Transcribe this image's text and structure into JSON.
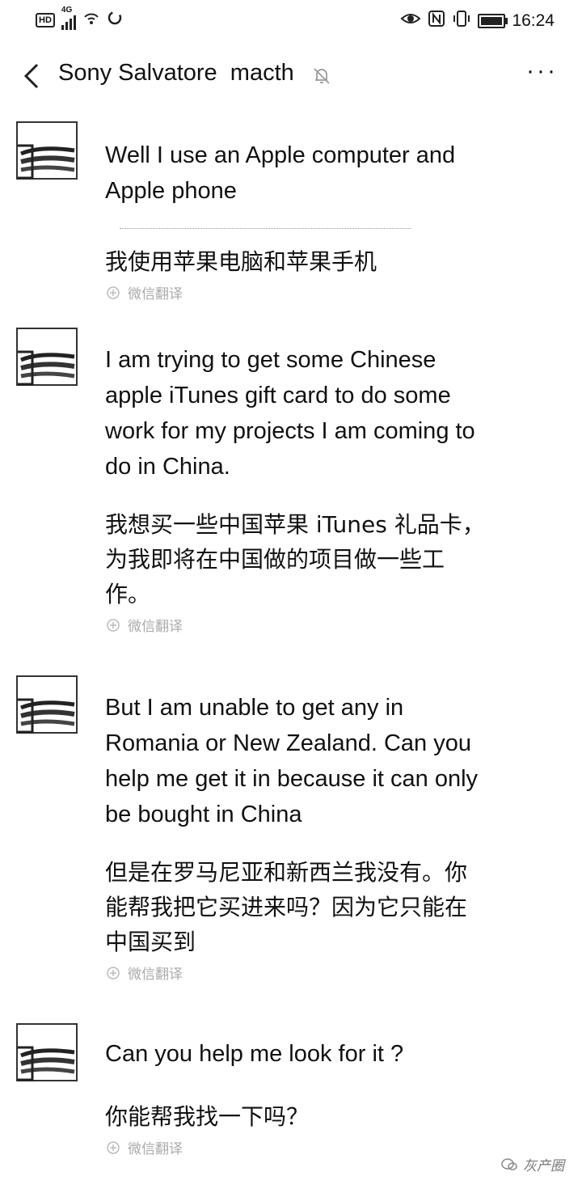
{
  "status_bar": {
    "hd": "HD",
    "network": "4G",
    "time": "16:24",
    "icons": [
      "signal-icon",
      "wifi-icon",
      "sync-icon",
      "eye-icon",
      "nfc-icon",
      "vibrate-icon",
      "battery-icon"
    ]
  },
  "header": {
    "title": "Sony Salvatore  macth",
    "back_icon": "chevron-left-icon",
    "mute_icon": "bell-off-icon",
    "more_label": "···"
  },
  "messages": [
    {
      "en": "Well I use an Apple computer and Apple phone",
      "zh": "我使用苹果电脑和苹果手机",
      "translate_label": "微信翻译"
    },
    {
      "en": "I am trying to get some Chinese apple iTunes gift card to do some work for my projects I am coming to do in China.",
      "zh": "我想买一些中国苹果 iTunes 礼品卡，为我即将在中国做的项目做一些工作。",
      "translate_label": "微信翻译"
    },
    {
      "en": "But I am unable to get any in Romania or New Zealand. Can you help me get it in because it can only be bought in China",
      "zh": "但是在罗马尼亚和新西兰我没有。你能帮我把它买进来吗？因为它只能在中国买到",
      "translate_label": "微信翻译"
    },
    {
      "en": "Can you help me look for it ?",
      "zh": "你能帮我找一下吗？",
      "translate_label": "微信翻译"
    }
  ],
  "watermark": "灰产圈"
}
